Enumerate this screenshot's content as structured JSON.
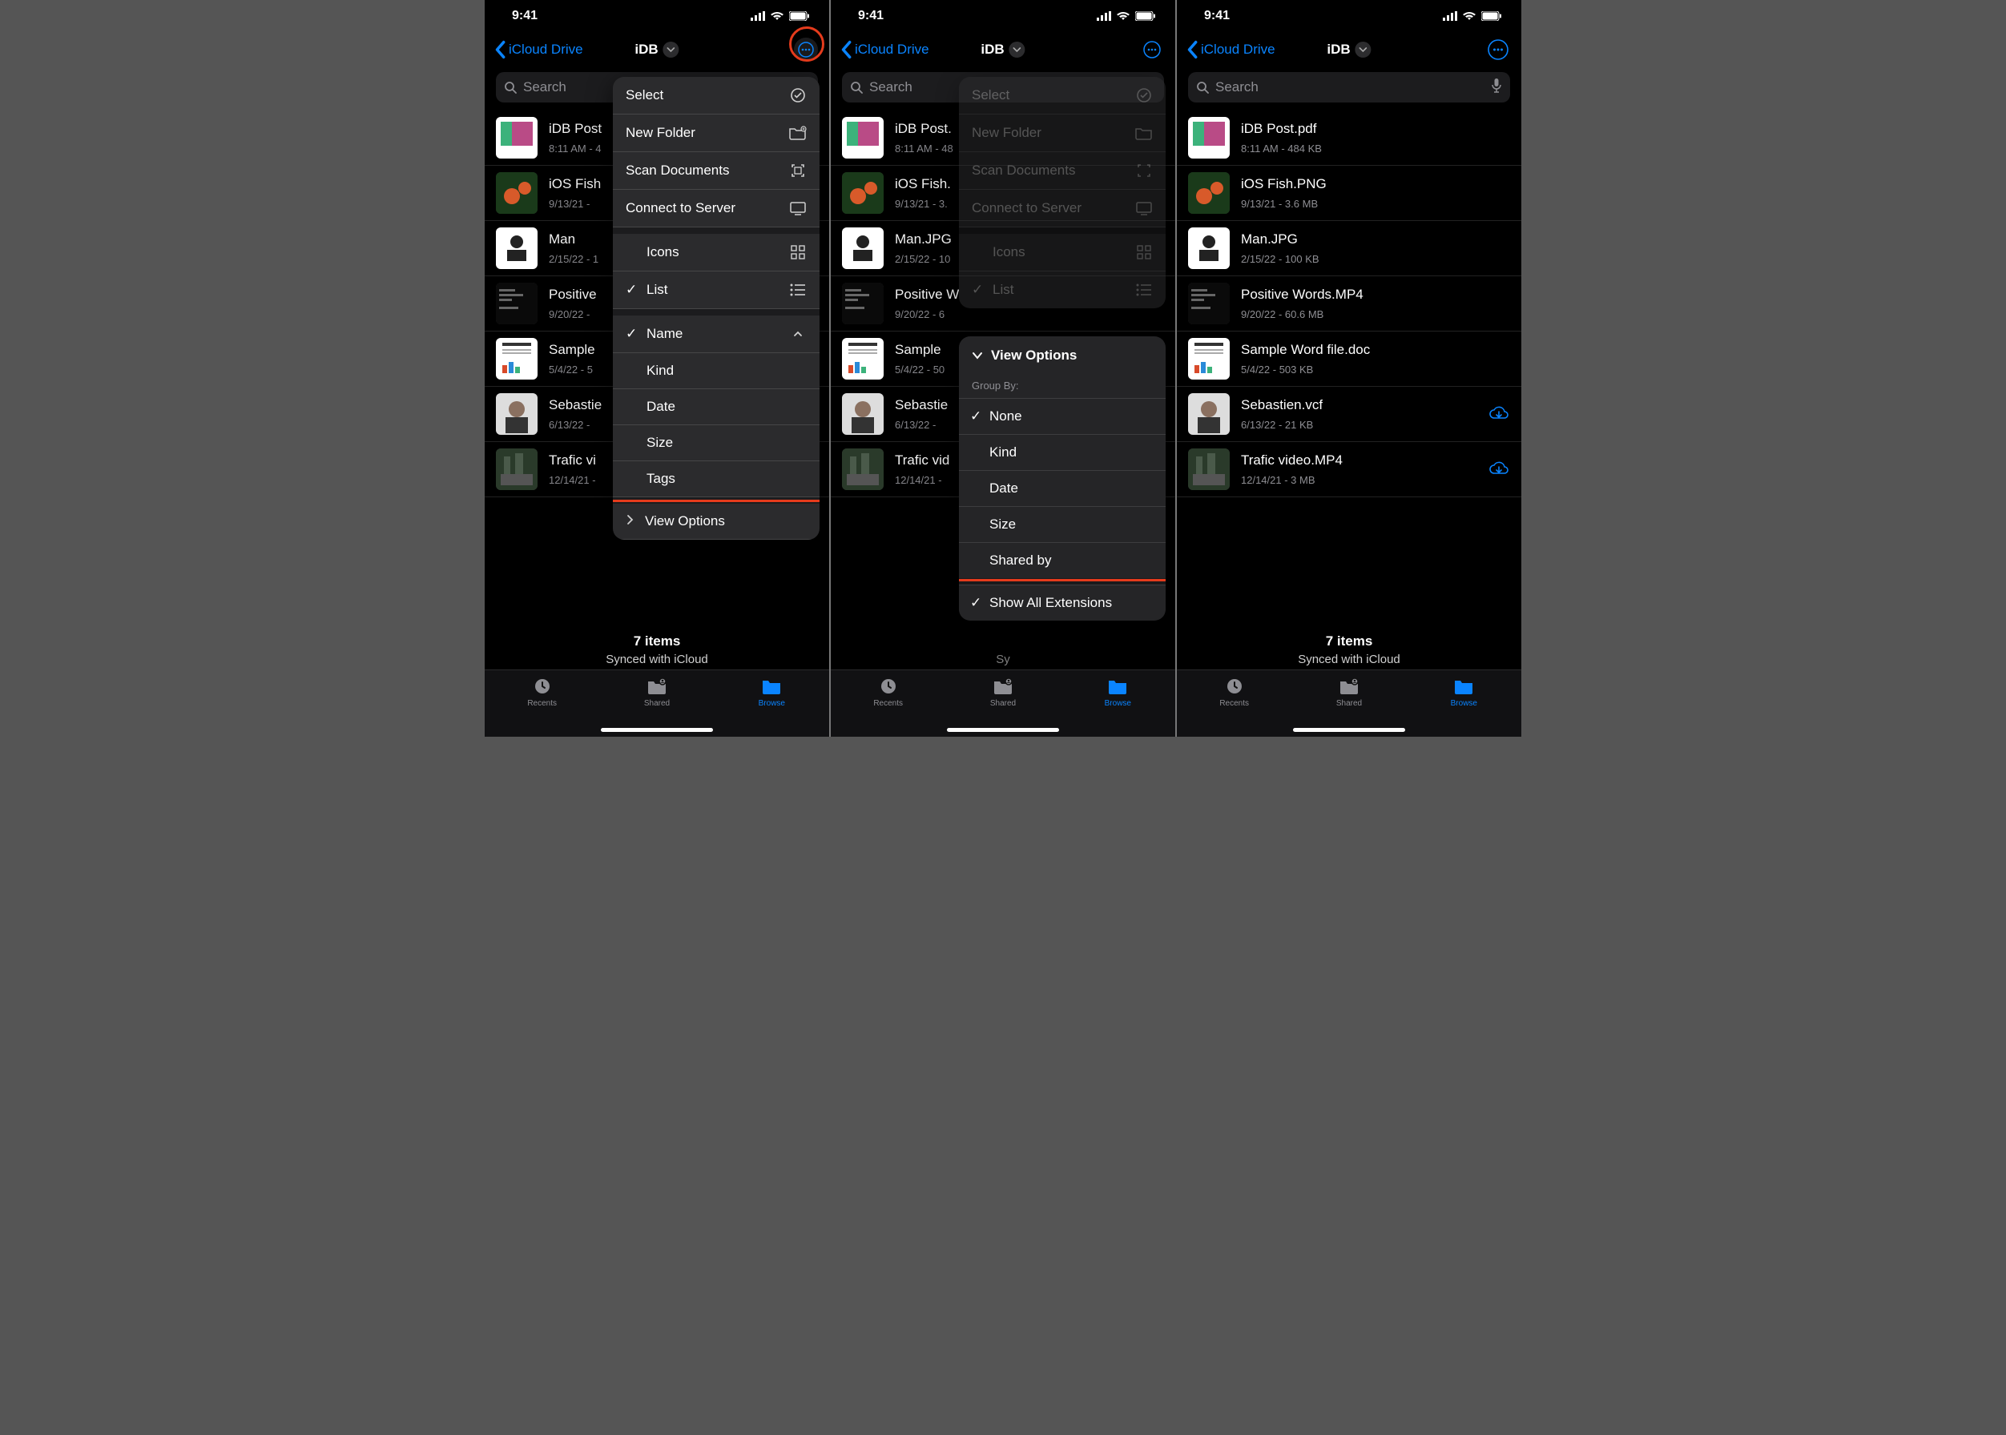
{
  "statusTime": "9:41",
  "backLabel": "iCloud Drive",
  "folderTitle": "iDB",
  "searchPlaceholder": "Search",
  "footer": {
    "count": "7 items",
    "sync": "Synced with iCloud"
  },
  "tabs": {
    "recents": "Recents",
    "shared": "Shared",
    "browse": "Browse"
  },
  "ctxMenu": {
    "select": "Select",
    "newFolder": "New Folder",
    "scan": "Scan Documents",
    "connect": "Connect to Server",
    "icons": "Icons",
    "list": "List",
    "name": "Name",
    "kind": "Kind",
    "date": "Date",
    "size": "Size",
    "tags": "Tags",
    "viewOptions": "View Options"
  },
  "viewOptions": {
    "title": "View Options",
    "groupBy": "Group By:",
    "none": "None",
    "kind": "Kind",
    "date": "Date",
    "size": "Size",
    "sharedBy": "Shared by",
    "showAll": "Show All Extensions"
  },
  "filesTruncA": [
    {
      "name": "iDB Post",
      "meta": "8:11 AM - 4"
    },
    {
      "name": "iOS Fish",
      "meta": "9/13/21 -"
    },
    {
      "name": "Man",
      "meta": "2/15/22 - 1"
    },
    {
      "name": "Positive ",
      "meta": "9/20/22 -"
    },
    {
      "name": "Sample ",
      "meta": "5/4/22 - 5"
    },
    {
      "name": "Sebastie",
      "meta": "6/13/22 -"
    },
    {
      "name": "Trafic vi",
      "meta": "12/14/21 -"
    }
  ],
  "filesTruncB": [
    {
      "name": "iDB Post.",
      "meta": "8:11 AM - 48"
    },
    {
      "name": "iOS Fish.",
      "meta": "9/13/21 - 3."
    },
    {
      "name": "Man.JPG",
      "meta": "2/15/22 - 10"
    },
    {
      "name": "Positive W",
      "meta": "9/20/22 - 6"
    },
    {
      "name": "Sample ",
      "meta": "5/4/22 - 50"
    },
    {
      "name": "Sebastie",
      "meta": "6/13/22 -"
    },
    {
      "name": "Trafic vid",
      "meta": "12/14/21 -"
    }
  ],
  "filesFull": [
    {
      "name": "iDB Post.pdf",
      "meta": "8:11 AM - 484 KB",
      "ustart": 66,
      "uwidth": 36
    },
    {
      "name": "iOS Fish.PNG",
      "meta": "9/13/21 - 3.6 MB",
      "ustart": 66,
      "uwidth": 44
    },
    {
      "name": "Man.JPG",
      "meta": "2/15/22 - 100 KB",
      "ustart": 38,
      "uwidth": 40
    },
    {
      "name": "Positive Words.MP4",
      "meta": "9/20/22 - 60.6 MB",
      "ustart": 128,
      "uwidth": 42
    },
    {
      "name": "Sample Word file.doc",
      "meta": "5/4/22 - 503 KB",
      "ustart": 144,
      "uwidth": 38
    },
    {
      "name": "Sebastien.vcf",
      "meta": "6/13/22 - 21 KB",
      "ustart": 82,
      "uwidth": 30,
      "cloud": true
    },
    {
      "name": "Trafic video.MP4",
      "meta": "12/14/21 - 3 MB",
      "ustart": 96,
      "uwidth": 44,
      "cloud": true
    }
  ]
}
